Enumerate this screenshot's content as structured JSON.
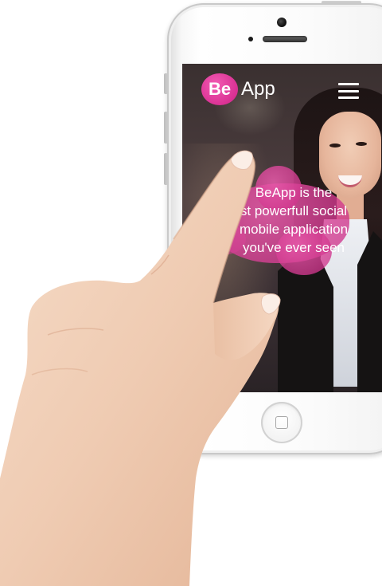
{
  "app": {
    "logo_badge": "Be",
    "logo_name": "App",
    "tagline_lines": [
      "BeApp is the",
      "st powerfull social",
      "mobile application",
      "you've ever seen"
    ]
  },
  "icons": {
    "menu": "hamburger-menu-icon",
    "home": "home-button-icon"
  },
  "colors": {
    "brand_pink": "#d4238e",
    "text_light": "#ffffff"
  }
}
